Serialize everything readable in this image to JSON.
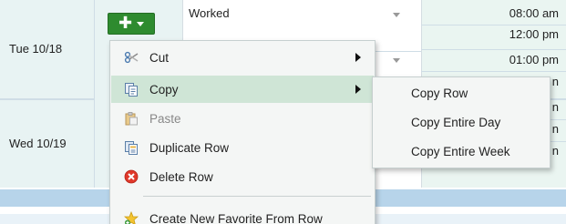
{
  "grid": {
    "days": [
      {
        "label": "Tue 10/18"
      },
      {
        "label": "Wed 10/19"
      }
    ],
    "row_type": "Worked",
    "times": [
      "08:00 am",
      "12:00 pm",
      "01:00 pm"
    ],
    "clipped_suffix": "n"
  },
  "add_button": {
    "plus": "✚"
  },
  "context_menu": {
    "items": [
      {
        "label": "Cut",
        "icon": "scissors-icon",
        "has_submenu": true,
        "enabled": true
      },
      {
        "label": "Copy",
        "icon": "copy-icon",
        "has_submenu": true,
        "enabled": true,
        "active": true
      },
      {
        "label": "Paste",
        "icon": "paste-icon",
        "has_submenu": false,
        "enabled": false
      },
      {
        "label": "Duplicate Row",
        "icon": "duplicate-icon",
        "has_submenu": false,
        "enabled": true
      },
      {
        "label": "Delete Row",
        "icon": "delete-icon",
        "has_submenu": false,
        "enabled": true
      },
      {
        "label": "Create New Favorite From Row",
        "icon": "favorite-star-icon",
        "has_submenu": false,
        "enabled": true
      }
    ]
  },
  "copy_submenu": {
    "items": [
      {
        "label": "Copy Row"
      },
      {
        "label": "Copy Entire Day"
      },
      {
        "label": "Copy Entire Week"
      }
    ]
  },
  "colors": {
    "add_button": "#2e8b2f",
    "menu_highlight": "#cfe5d6",
    "total_bar": "#b7d4ea",
    "delete_icon": "#e0382a"
  }
}
